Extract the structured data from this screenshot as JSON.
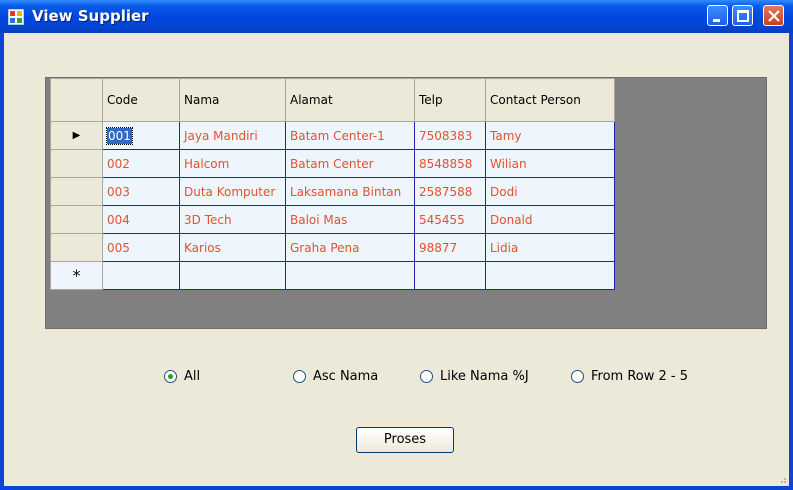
{
  "window": {
    "title": "View Supplier"
  },
  "grid": {
    "columns": [
      "Code",
      "Nama",
      "Alamat",
      "Telp",
      "Contact Person"
    ],
    "rows": [
      [
        "001",
        "Jaya Mandiri",
        "Batam Center-1",
        "7508383",
        "Tamy"
      ],
      [
        "002",
        "Halcom",
        "Batam Center",
        "8548858",
        "Wilian"
      ],
      [
        "003",
        "Duta Komputer",
        "Laksamana Bintan",
        "2587588",
        "Dodi"
      ],
      [
        "004",
        "3D Tech",
        "Baloi Mas",
        "545455",
        "Donald"
      ],
      [
        "005",
        "Karios",
        "Graha Pena",
        "98877",
        "Lidia"
      ]
    ],
    "current_row_indicator": "▶",
    "new_row_indicator": "*"
  },
  "options": [
    {
      "label": "All",
      "selected": true
    },
    {
      "label": "Asc Nama",
      "selected": false
    },
    {
      "label": "Like Nama %J",
      "selected": false
    },
    {
      "label": "From Row 2 - 5",
      "selected": false
    }
  ],
  "actions": {
    "process_label": "Proses"
  },
  "colors": {
    "titlebar": "#0048e0",
    "cell_text": "#e2522c",
    "grid_background": "#808080"
  }
}
